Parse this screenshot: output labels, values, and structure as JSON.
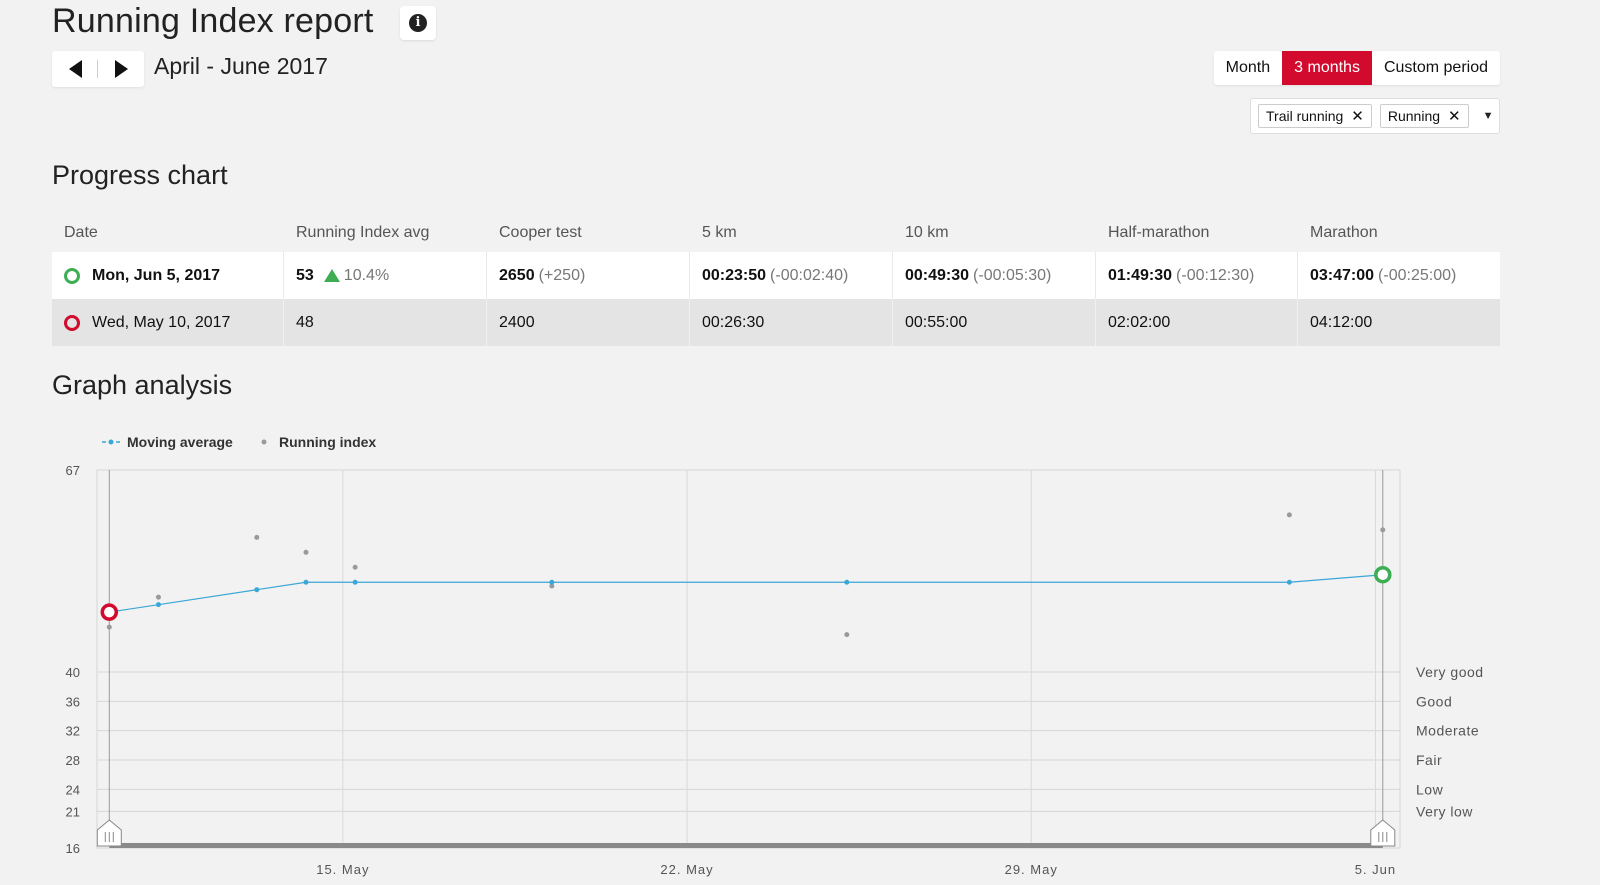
{
  "header": {
    "title": "Running Index report",
    "info_icon": "info-circle-icon",
    "period_label": "April - June 2017"
  },
  "period_tabs": [
    {
      "label": "Month",
      "active": false
    },
    {
      "label": "3 months",
      "active": true
    },
    {
      "label": "Custom period",
      "active": false
    }
  ],
  "filters": {
    "chips": [
      {
        "label": "Trail running"
      },
      {
        "label": "Running"
      }
    ]
  },
  "progress": {
    "title": "Progress chart",
    "columns": [
      "Date",
      "Running Index avg",
      "Cooper test",
      "5 km",
      "10 km",
      "Half-marathon",
      "Marathon"
    ],
    "rows": [
      {
        "date": "Mon, Jun 5, 2017",
        "ri": "53",
        "ri_change": "10.4%",
        "cooper": "2650",
        "cooper_delta": "(+250)",
        "km5": "00:23:50",
        "km5_delta": "(-00:02:40)",
        "km10": "00:49:30",
        "km10_delta": "(-00:05:30)",
        "half": "01:49:30",
        "half_delta": "(-00:12:30)",
        "marathon": "03:47:00",
        "marathon_delta": "(-00:25:00)"
      },
      {
        "date": "Wed, May 10, 2017",
        "ri": "48",
        "cooper": "2400",
        "km5": "00:26:30",
        "km10": "00:55:00",
        "half": "02:02:00",
        "marathon": "04:12:00"
      }
    ]
  },
  "graph": {
    "title": "Graph analysis"
  },
  "colors": {
    "accent": "#d10a2e",
    "good": "#3dae54",
    "moving_average": "#3aa7d6",
    "running_index": "#999999"
  },
  "chart_data": {
    "type": "line",
    "legend": [
      "Moving average",
      "Running index"
    ],
    "legend_position": "top-left",
    "y_ticks": [
      16,
      21,
      24,
      28,
      32,
      36,
      40,
      67
    ],
    "ylim": [
      16,
      67
    ],
    "x_ticks": [
      {
        "label": "15. May",
        "day": 15
      },
      {
        "label": "22. May",
        "day": 22
      },
      {
        "label": "29. May",
        "day": 29
      },
      {
        "label": "5. Jun",
        "day": 36
      }
    ],
    "xlim_days": [
      10,
      36.5
    ],
    "zones": [
      {
        "label": "Very good",
        "value": 40
      },
      {
        "label": "Good",
        "value": 36
      },
      {
        "label": "Moderate",
        "value": 32
      },
      {
        "label": "Fair",
        "value": 28
      },
      {
        "label": "Low",
        "value": 24
      },
      {
        "label": "Very low",
        "value": 21
      }
    ],
    "series": [
      {
        "name": "Moving average",
        "points": [
          [
            10.25,
            48
          ],
          [
            11.25,
            49
          ],
          [
            13.25,
            51
          ],
          [
            14.25,
            52
          ],
          [
            15.25,
            52
          ],
          [
            19.25,
            52
          ],
          [
            25.25,
            52
          ],
          [
            34.25,
            52
          ],
          [
            36.15,
            53
          ]
        ]
      },
      {
        "name": "Running index",
        "points": [
          [
            10.25,
            46
          ],
          [
            11.25,
            50
          ],
          [
            13.25,
            58
          ],
          [
            14.25,
            56
          ],
          [
            15.25,
            54
          ],
          [
            19.25,
            51.5
          ],
          [
            25.25,
            45
          ],
          [
            34.25,
            61
          ],
          [
            36.15,
            59
          ]
        ]
      }
    ],
    "markers": [
      {
        "day": 10.25,
        "value": 48,
        "color": "#d10a2e"
      },
      {
        "day": 36.15,
        "value": 53,
        "color": "#3dae54"
      }
    ],
    "grid": true
  }
}
